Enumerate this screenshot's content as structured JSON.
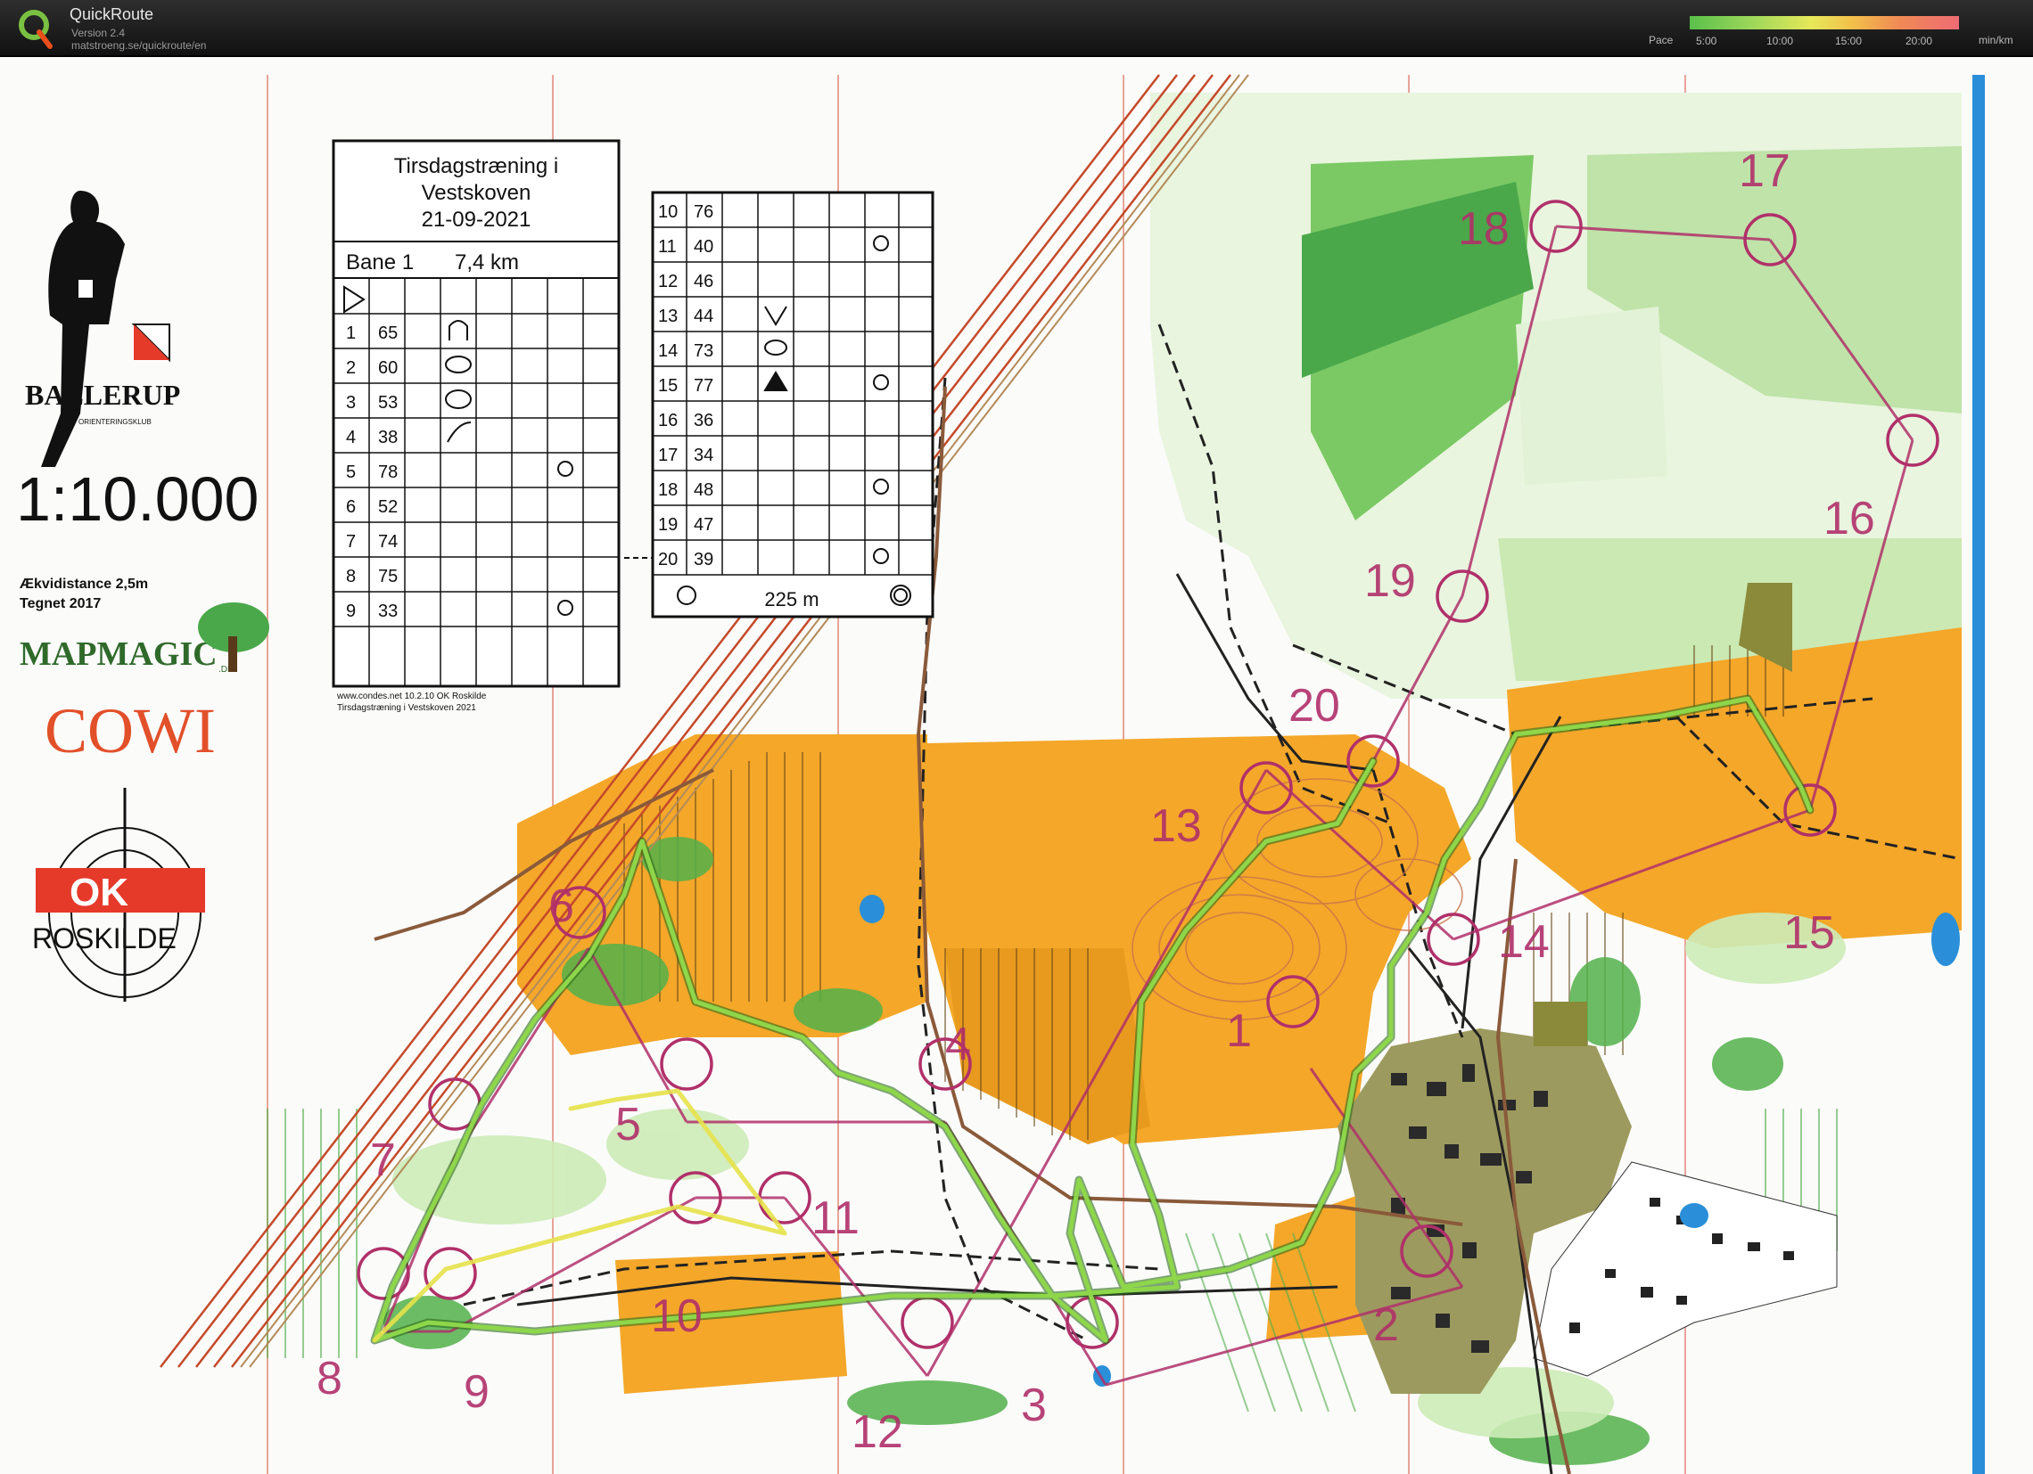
{
  "app": {
    "title": "QuickRoute",
    "version": "Version 2.4",
    "url": "matstroeng.se/quickroute/en"
  },
  "pace": {
    "label": "Pace",
    "unit": "min/km",
    "ticks": [
      "5:00",
      "10:00",
      "15:00",
      "20:00"
    ]
  },
  "map": {
    "club_name": "BALLERUP",
    "club_sub": "ORIENTERINGSKLUB",
    "scale": "1:10.000",
    "contour_interval": "Ækvidistance 2,5m",
    "drawn": "Tegnet 2017",
    "brand_mapmagic": "MAPMAGIC",
    "brand_mapmagic_suffix": ".DK",
    "brand_cowi": "COWI",
    "brand_roskilde": "ROSKILDE",
    "brand_ok": "OK",
    "credit_line1": "www.condes.net 10.2.10 OK Roskilde",
    "credit_line2": "Tirsdagstræning i Vestskoven 2021"
  },
  "event": {
    "title_line1": "Tirsdagstræning i",
    "title_line2": "Vestskoven",
    "date": "21-09-2021",
    "course": "Bane 1",
    "distance": "7,4 km",
    "finish_distance": "225 m"
  },
  "controls_left": [
    {
      "n": "1",
      "code": "65"
    },
    {
      "n": "2",
      "code": "60"
    },
    {
      "n": "3",
      "code": "53"
    },
    {
      "n": "4",
      "code": "38"
    },
    {
      "n": "5",
      "code": "78"
    },
    {
      "n": "6",
      "code": "52"
    },
    {
      "n": "7",
      "code": "74"
    },
    {
      "n": "8",
      "code": "75"
    },
    {
      "n": "9",
      "code": "33"
    }
  ],
  "controls_right": [
    {
      "n": "10",
      "code": "76"
    },
    {
      "n": "11",
      "code": "40"
    },
    {
      "n": "12",
      "code": "46"
    },
    {
      "n": "13",
      "code": "44"
    },
    {
      "n": "14",
      "code": "73"
    },
    {
      "n": "15",
      "code": "77"
    },
    {
      "n": "16",
      "code": "36"
    },
    {
      "n": "17",
      "code": "34"
    },
    {
      "n": "18",
      "code": "48"
    },
    {
      "n": "19",
      "code": "47"
    },
    {
      "n": "20",
      "code": "39"
    }
  ],
  "control_labels": [
    "1",
    "2",
    "3",
    "4",
    "5",
    "6",
    "7",
    "8",
    "9",
    "10",
    "11",
    "12",
    "13",
    "14",
    "15",
    "16",
    "17",
    "18",
    "19",
    "20"
  ],
  "colors": {
    "forest_open": "#f5a623",
    "green": "#4bb04a",
    "light_green": "#bfe6a0",
    "purple": "#b0306a",
    "route": "#6cb83a",
    "water": "#1e7fd6"
  }
}
